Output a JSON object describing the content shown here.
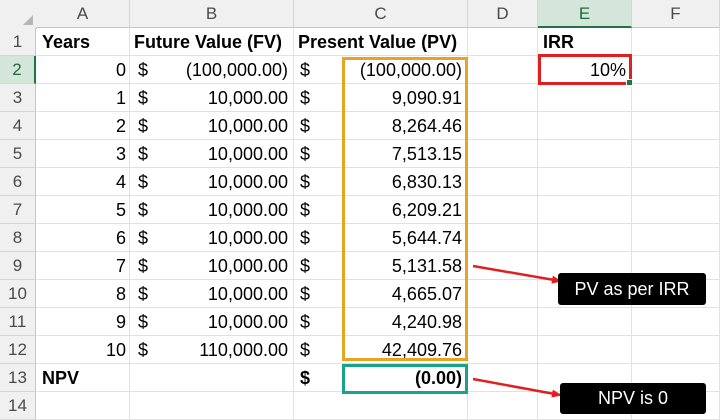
{
  "columns": [
    "A",
    "B",
    "C",
    "D",
    "E",
    "F"
  ],
  "rows": [
    "1",
    "2",
    "3",
    "4",
    "5",
    "6",
    "7",
    "8",
    "9",
    "10",
    "11",
    "12",
    "13",
    "14"
  ],
  "headers": {
    "years": "Years",
    "fv": "Future Value (FV)",
    "pv": "Present Value (PV)",
    "irr": "IRR"
  },
  "currency": "$",
  "data_rows": [
    {
      "year": "0",
      "fv": "(100,000.00)",
      "pv": "(100,000.00)"
    },
    {
      "year": "1",
      "fv": "10,000.00",
      "pv": "9,090.91"
    },
    {
      "year": "2",
      "fv": "10,000.00",
      "pv": "8,264.46"
    },
    {
      "year": "3",
      "fv": "10,000.00",
      "pv": "7,513.15"
    },
    {
      "year": "4",
      "fv": "10,000.00",
      "pv": "6,830.13"
    },
    {
      "year": "5",
      "fv": "10,000.00",
      "pv": "6,209.21"
    },
    {
      "year": "6",
      "fv": "10,000.00",
      "pv": "5,644.74"
    },
    {
      "year": "7",
      "fv": "10,000.00",
      "pv": "5,131.58"
    },
    {
      "year": "8",
      "fv": "10,000.00",
      "pv": "4,665.07"
    },
    {
      "year": "9",
      "fv": "10,000.00",
      "pv": "4,240.98"
    },
    {
      "year": "10",
      "fv": "110,000.00",
      "pv": "42,409.76"
    }
  ],
  "irr_value": "10%",
  "npv": {
    "label": "NPV",
    "value": "(0.00)"
  },
  "callouts": {
    "pv": "PV as per IRR",
    "npv": "NPV is 0"
  },
  "colors": {
    "irr_box": "#e02020",
    "pv_box": "#e5a423",
    "npv_box": "#19a38a",
    "arrow": "#e02020",
    "selection": "#217346"
  }
}
